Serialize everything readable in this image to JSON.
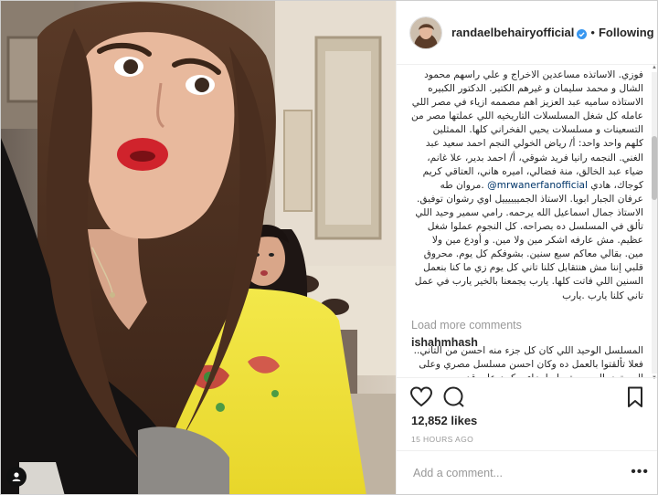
{
  "header": {
    "username": "randaelbehairyofficial",
    "separator": "•",
    "follow_label": "Following"
  },
  "comments": {
    "main_before_mention": "فوزي. الاساتذه مساعدين الاخراج و علي راسهم محمود الشال و محمد سليمان و غيرهم الكتير. الدكتور الكبيره الاستاذه ساميه عبد العزيز اهم مصممه ازياء في مصر اللي عامله كل شغل المسلسلات التاريخيه اللي عملتها مصر من التسعينات و مسلسلات يحيي الفخراني كلها. الممثلين كلهم واحد واحد: أ/ رياض الخولي النجم احمد سعيد عبد الغني. النجمه رانيا فريد شوقي، أ/ احمد بدير، علا غانم، ضياء عبد الخالق، منة فضالي، اميره هاني، العتاقي كريم كوجاك، هادي",
    "mention": "@mrwanerfanofficial",
    "main_after_mention": ".مروان طه عرفان الجبار ابويا. الاستاذ الجمييييييل اوي رشوان توفيق. الاستاذ جمال اسماعيل الله يرحمه. رامي سمير وحيد اللي تألق في المسلسل ده بصراحه. كل النجوم عملوا شغل عظيم. مش عارفه اشكر مين ولا مين. و أودع مين ولا مين. بقالي معاكم سبع سنين. بشوفكم كل يوم. محروق قلبي إننا مش هنتقابل كلنا تاني كل يوم زي ما كنا بنعمل السنين اللي فاتت كلها. يارب يجمعنا بالخير يارب في عمل تاني كلنا يارب .يارب",
    "load_more": "Load more comments",
    "second_user": "ishahmhash",
    "second_text": "المسلسل الوحيد اللي كان كل جزء منه احسن من التاني.. فعلا تألقتوا بالعمل ده وكان احسن مسلسل مصري وعلى المستوى العربي بتعمله اجزاء ويكون على قد"
  },
  "likes": "12,852 likes",
  "time": "15 HOURS AGO",
  "add_comment": {
    "placeholder": "Add a comment..."
  },
  "more_label": "•••",
  "icons": {
    "like": "heart-outline-icon",
    "comment": "speech-bubble-icon",
    "save": "bookmark-icon",
    "verified": "verified-badge-icon",
    "corner": "person-silhouette-icon"
  },
  "colors": {
    "text": "#262626",
    "muted": "#999999",
    "link": "#003569",
    "verified": "#3897f0",
    "dress": "#f2e43b"
  }
}
